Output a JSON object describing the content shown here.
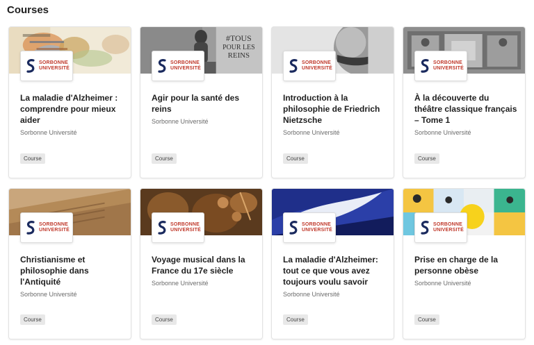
{
  "page": {
    "heading": "Courses"
  },
  "brand": {
    "logo_line1": "SORBONNE",
    "logo_line2": "UNIVERSITÉ",
    "logo_color": "#c0392b",
    "mark_color": "#1a2a5e"
  },
  "banners": {
    "b5": {
      "overlay_text_line1": "#TOUS",
      "overlay_text_line2": "POUR LES",
      "overlay_text_line3": "REINS"
    }
  },
  "courses": [
    {
      "title": "La maladie d'Alzheimer : comprendre pour mieux aider",
      "org": "Sorbonne Université",
      "badge": "Course"
    },
    {
      "title": "Agir pour la santé des reins",
      "org": "Sorbonne Université",
      "badge": "Course"
    },
    {
      "title": "Introduction à la philosophie de Friedrich Nietzsche",
      "org": "Sorbonne Université",
      "badge": "Course"
    },
    {
      "title": "À la découverte du théâtre classique français – Tome 1",
      "org": "Sorbonne Université",
      "badge": "Course"
    },
    {
      "title": "Christianisme et philosophie dans l'Antiquité",
      "org": "Sorbonne Université",
      "badge": "Course"
    },
    {
      "title": "Voyage musical dans la France du 17e siècle",
      "org": "Sorbonne Université",
      "badge": "Course"
    },
    {
      "title": "La maladie d'Alzheimer: tout ce que vous avez toujours voulu savoir",
      "org": "Sorbonne Université",
      "badge": "Course"
    },
    {
      "title": "Prise en charge de la personne obèse",
      "org": "Sorbonne Université",
      "badge": "Course"
    }
  ]
}
